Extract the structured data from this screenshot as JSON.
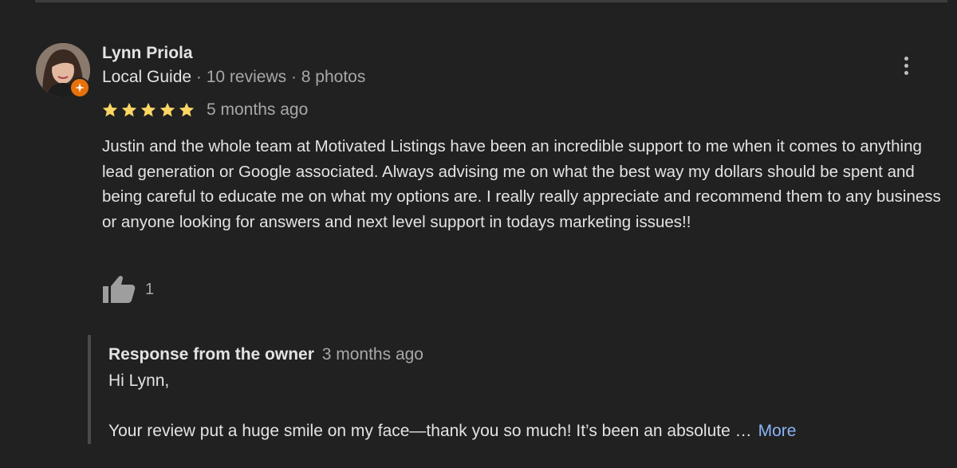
{
  "review": {
    "reviewer": {
      "name": "Lynn Priola",
      "badge": "Local Guide",
      "stats": " · 10 reviews · 8 photos",
      "avatar_icon": "profile-photo",
      "badge_icon": "local-guide-star-icon"
    },
    "rating": {
      "stars": 5,
      "max": 5,
      "star_color": "#fdd663"
    },
    "age": "5 months ago",
    "text": "Justin and the whole team at Motivated Listings have been an incredible support to me when it comes to anything lead generation or Google associated. Always advising me on what the best way my dollars should be spent and being careful to educate me on what my options are. I really really appreciate and recommend them to any business or anyone looking for answers and next level support in todays marketing issues!!",
    "likes": "1",
    "like_icon": "thumbs-up-icon",
    "menu_icon": "more-vert-icon"
  },
  "owner_response": {
    "title": "Response from the owner",
    "age": "3 months ago",
    "greeting": "Hi Lynn,",
    "body": "Your review put a huge smile on my face—thank you so much! It’s been an absolute …",
    "more_label": "More"
  },
  "colors": {
    "background": "#212121",
    "text": "#e3e3e3",
    "secondary_text": "#a8a8a8",
    "link": "#8ab4f8",
    "badge": "#e8710a"
  }
}
